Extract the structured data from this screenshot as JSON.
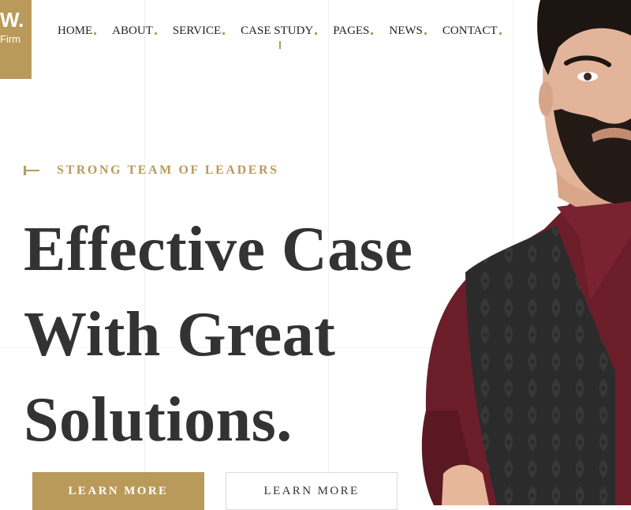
{
  "logo": {
    "mark": "W.",
    "sub": "Firm"
  },
  "nav": {
    "items": [
      {
        "label": "HOME"
      },
      {
        "label": "ABOUT"
      },
      {
        "label": "SERVICE"
      },
      {
        "label": "CASE STUDY"
      },
      {
        "label": "PAGES"
      },
      {
        "label": "NEWS"
      },
      {
        "label": "CONTACT"
      }
    ],
    "active_index": 3
  },
  "hero": {
    "eyebrow": "STRONG TEAM OF LEADERS",
    "headline_lines": [
      "Effective Case",
      "With Great",
      "Solutions."
    ],
    "primary_button": "LEARN MORE",
    "secondary_button": "LEARN MORE"
  },
  "colors": {
    "accent": "#b99a5b",
    "heading": "#333333",
    "shirt": "#6e1f2a",
    "vest": "#2a2a2a"
  }
}
